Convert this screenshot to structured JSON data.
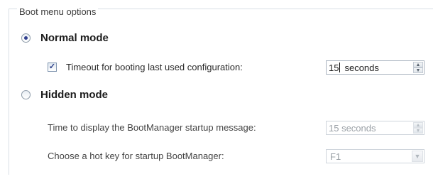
{
  "group": {
    "title": "Boot menu options"
  },
  "normal_mode": {
    "label": "Normal mode",
    "selected": true,
    "timeout_checkbox": {
      "label": "Timeout for booting last used configuration:",
      "checked": true
    },
    "timeout_value": "15",
    "timeout_unit": "seconds"
  },
  "hidden_mode": {
    "label": "Hidden mode",
    "selected": false,
    "display_time_label": "Time to display the BootManager startup message:",
    "display_time_value": "15 seconds",
    "hotkey_label": "Choose a hot key for startup BootManager:",
    "hotkey_value": "F1"
  },
  "icons": {
    "check": "✓",
    "spin_up": "▲",
    "spin_down": "▼",
    "dropdown": "▼"
  }
}
